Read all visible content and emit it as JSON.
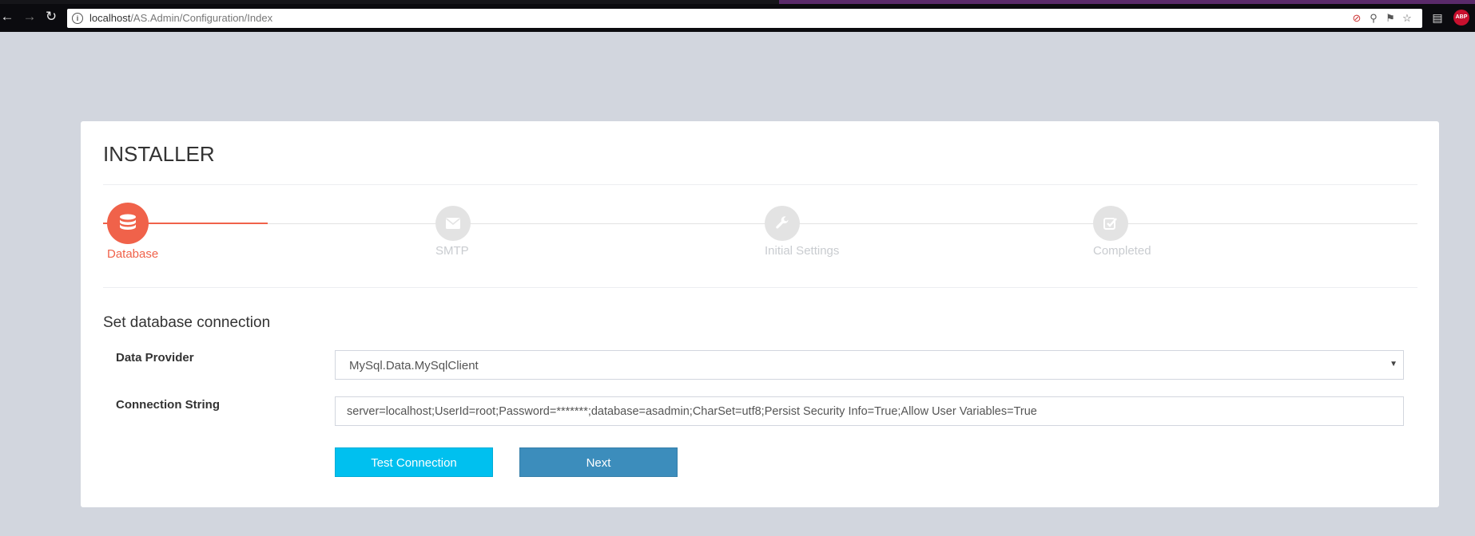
{
  "browser": {
    "url_host": "localhost",
    "url_path": "/AS.Admin/Configuration/Index",
    "extensions": [
      "blocked-icon",
      "zoom-icon",
      "key-icon",
      "star-icon"
    ],
    "abp_label": "ABP"
  },
  "colors": {
    "accent": "#f0624a",
    "inactive": "#e3e3e3",
    "btn_info": "#00c0ef",
    "btn_primary": "#3c8dbc",
    "page_bg": "#d2d6de"
  },
  "installer": {
    "title": "INSTALLER",
    "steps": [
      {
        "label": "Database",
        "icon": "database-icon",
        "active": true
      },
      {
        "label": "SMTP",
        "icon": "envelope-icon",
        "active": false
      },
      {
        "label": "Initial Settings",
        "icon": "wrench-icon",
        "active": false
      },
      {
        "label": "Completed",
        "icon": "check-square-icon",
        "active": false
      }
    ],
    "section_title": "Set database connection",
    "form": {
      "data_provider_label": "Data Provider",
      "data_provider_value": "MySql.Data.MySqlClient",
      "connection_string_label": "Connection String",
      "connection_string_value": "server=localhost;UserId=root;Password=*******;database=asadmin;CharSet=utf8;Persist Security Info=True;Allow User Variables=True"
    },
    "buttons": {
      "test": "Test Connection",
      "next": "Next"
    }
  }
}
